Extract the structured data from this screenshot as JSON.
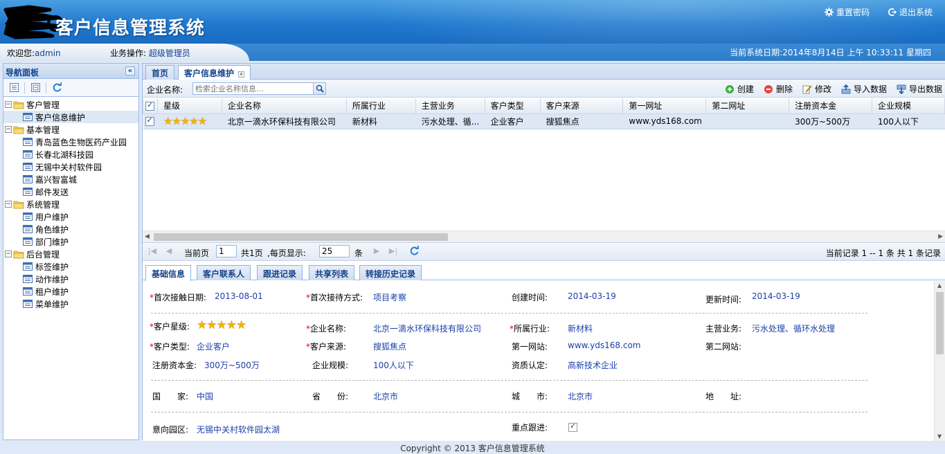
{
  "header": {
    "title": "客户信息管理系统",
    "reset_password": "重置密码",
    "logout": "退出系统"
  },
  "infobar": {
    "welcome_label": "欢迎您:",
    "user": "admin",
    "operation_label": "业务操作:",
    "operation_value": "超级管理员",
    "date_text": "当前系统日期:2014年8月14日 上午 10:33:11 星期四"
  },
  "sidebar": {
    "title": "导航面板",
    "tree": [
      {
        "label": "客户管理",
        "children": [
          "客户信息维护"
        ]
      },
      {
        "label": "基本管理",
        "children": [
          "青岛蓝色生物医药产业园",
          "长春北湖科技园",
          "无锡中关村软件园",
          "嘉兴智富城",
          "邮件发送"
        ]
      },
      {
        "label": "系统管理",
        "children": [
          "用户维护",
          "角色维护",
          "部门维护"
        ]
      },
      {
        "label": "后台管理",
        "children": [
          "标签维护",
          "动作维护",
          "租户维护",
          "菜单维护"
        ]
      }
    ]
  },
  "tabs": {
    "home": "首页",
    "current": "客户信息维护"
  },
  "toolbar": {
    "company_label": "企业名称:",
    "search_placeholder": "检索企业名称信息...",
    "create": "创建",
    "delete": "删除",
    "edit": "修改",
    "import": "导入数据",
    "export": "导出数据"
  },
  "grid": {
    "columns": [
      "星级",
      "企业名称",
      "所属行业",
      "主营业务",
      "客户类型",
      "客户来源",
      "第一网址",
      "第二网址",
      "注册资本金",
      "企业规模"
    ],
    "rows": [
      {
        "stars": "★★★★★",
        "rating": 5,
        "company": "北京一滴水环保科技有限公司",
        "industry": "新材料",
        "business": "污水处理、循...",
        "type": "企业客户",
        "source": "搜狐焦点",
        "url1": "www.yds168.com",
        "url2": "",
        "capital": "300万~500万",
        "scale": "100人以下"
      }
    ]
  },
  "pager": {
    "current_page_label": "当前页",
    "page": "1",
    "total_pages": "共1页",
    "per_page_label": ",每页显示:",
    "per_page": "25",
    "unit": "条",
    "summary": "当前记录 1 -- 1 条 共 1 条记录"
  },
  "detail_tabs": [
    "基础信息",
    "客户联系人",
    "跟进记录",
    "共享列表",
    "转接历史记录"
  ],
  "detail": {
    "first_contact_date_label": "首次接触日期:",
    "first_contact_date": "2013-08-01",
    "first_contact_method_label": "首次接待方式:",
    "first_contact_method": "项目考察",
    "created_label": "创建时间:",
    "created": "2014-03-19",
    "updated_label": "更新时间:",
    "updated": "2014-03-19",
    "rating_label": "客户星级:",
    "rating_stars": "★★★★★",
    "company_label": "企业名称:",
    "company": "北京一滴水环保科技有限公司",
    "industry_label": "所属行业:",
    "industry": "新材料",
    "business_label": "主营业务:",
    "business": "污水处理、循环水处理",
    "type_label": "客户类型:",
    "type": "企业客户",
    "source_label": "客户来源:",
    "source": "搜狐焦点",
    "url1_label": "第一网站:",
    "url1": "www.yds168.com",
    "url2_label": "第二网站:",
    "capital_label": "注册资本金:",
    "capital": "300万~500万",
    "scale_label": "企业规模:",
    "scale": "100人以下",
    "qualification_label": "资质认定:",
    "qualification": "高新技术企业",
    "country_label": "国　　家:",
    "country": "中国",
    "province_label": "省　　份:",
    "province": "北京市",
    "city_label": "城　　市:",
    "city": "北京市",
    "address_label": "地　　址:",
    "park_label": "意向园区:",
    "park": "无锡中关村软件园太湖",
    "key_follow_label": "重点跟进:"
  },
  "footer": "Copyright © 2013 客户信息管理系统"
}
